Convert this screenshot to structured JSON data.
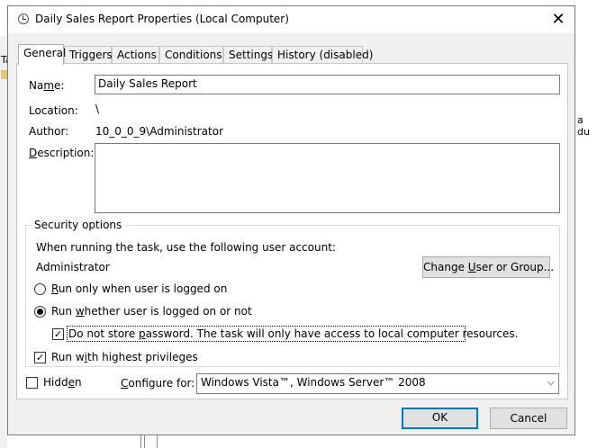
{
  "background": {
    "fragment_left_top": "Ta",
    "fragment_right": "a du"
  },
  "dialog": {
    "title": "Daily Sales Report Properties (Local Computer)",
    "close_glyph": "✕"
  },
  "tabs": [
    {
      "label": "General",
      "active": true
    },
    {
      "label": "Triggers",
      "active": false
    },
    {
      "label": "Actions",
      "active": false
    },
    {
      "label": "Conditions",
      "active": false
    },
    {
      "label": "Settings",
      "active": false
    },
    {
      "label": "History (disabled)",
      "active": false
    }
  ],
  "general": {
    "name_label_pre": "Na",
    "name_label_u": "m",
    "name_label_post": "e:",
    "name_value": "Daily Sales Report",
    "location_label": "Location:",
    "location_value": "\\",
    "author_label": "Author:",
    "author_value": "10_0_0_9\\Administrator",
    "description_label_u": "D",
    "description_label_post": "escription:",
    "description_value": ""
  },
  "security": {
    "title": "Security options",
    "account_prompt": "When running the task, use the following user account:",
    "account_name": "Administrator",
    "change_user_pre": "Change ",
    "change_user_u": "U",
    "change_user_post": "ser or Group...",
    "radio_logged_on_u": "R",
    "radio_logged_on_post": "un only when user is logged on",
    "radio_logged_on_checked": false,
    "radio_whether_pre": "Run ",
    "radio_whether_u": "w",
    "radio_whether_post": "hether user is logged on or not",
    "radio_whether_checked": true,
    "no_store_pre": "Do not store ",
    "no_store_u": "p",
    "no_store_post": "assword.  The task will only have access to local computer resources.",
    "no_store_checked": true,
    "highest_pre": "Run w",
    "highest_u": "i",
    "highest_post": "th highest privileges",
    "highest_checked": true,
    "check_glyph": "✓"
  },
  "footer": {
    "hidden_pre": "Hidd",
    "hidden_u": "e",
    "hidden_post": "n",
    "hidden_checked": false,
    "configure_label_u": "C",
    "configure_label_post": "onfigure for:",
    "configure_value": "Windows Vista™, Windows Server™ 2008",
    "dropdown_glyph": "⌵",
    "ok_label": "OK",
    "cancel_label": "Cancel"
  }
}
